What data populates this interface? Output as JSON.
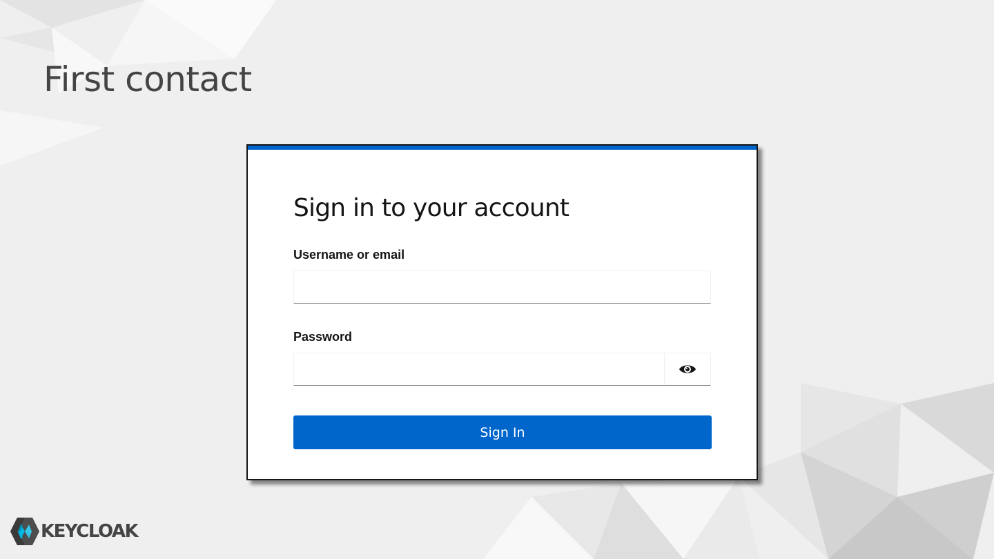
{
  "slide": {
    "title": "First contact"
  },
  "login": {
    "heading": "Sign in to your account",
    "username_label": "Username or email",
    "username_value": "",
    "password_label": "Password",
    "password_value": "",
    "toggle_icon": "eye-icon",
    "submit_label": "Sign In"
  },
  "brand": {
    "logo_text": "KEYCLOAK"
  },
  "colors": {
    "accent": "#0066cc",
    "background": "#efefef",
    "card": "#ffffff",
    "text": "#151515"
  }
}
